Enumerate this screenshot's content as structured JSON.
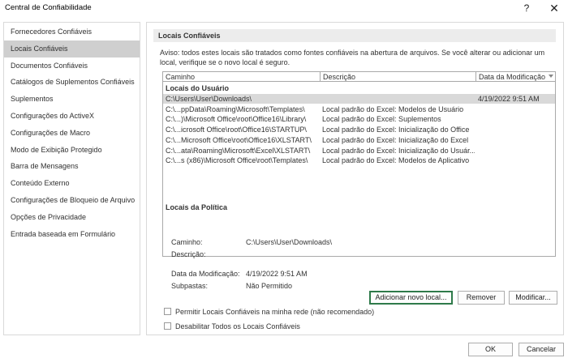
{
  "window": {
    "title": "Central de Confiabilidade",
    "help_label": "?",
    "close_label": "✕"
  },
  "sidebar": {
    "selected_index": 1,
    "items": [
      {
        "label": "Fornecedores Confiáveis"
      },
      {
        "label": "Locais Confiáveis"
      },
      {
        "label": "Documentos Confiáveis"
      },
      {
        "label": "Catálogos de Suplementos Confiáveis"
      },
      {
        "label": "Suplementos"
      },
      {
        "label": "Configurações do ActiveX"
      },
      {
        "label": "Configurações de Macro"
      },
      {
        "label": "Modo de Exibição Protegido"
      },
      {
        "label": "Barra de Mensagens"
      },
      {
        "label": "Conteúdo Externo"
      },
      {
        "label": "Configurações de Bloqueio de Arquivo"
      },
      {
        "label": "Opções de Privacidade"
      },
      {
        "label": "Entrada baseada em Formulário"
      }
    ]
  },
  "main": {
    "section_title": "Locais Confiáveis",
    "notice_line1": "Aviso: todos estes locais são tratados como fontes confiáveis na abertura de arquivos.  Se você alterar ou adicionar um",
    "notice_line2": "local, verifique se o novo local é seguro.",
    "columns": {
      "path": "Caminho",
      "description": "Descrição",
      "modified": "Data da Modificação"
    },
    "user_group_label": "Locais do Usuário",
    "policy_group_label": "Locais da Política",
    "user_rows": [
      {
        "path": "C:\\Users\\User\\Downloads\\",
        "description": "",
        "modified": "4/19/2022 9:51 AM",
        "selected": true
      },
      {
        "path": "C:\\...ppData\\Roaming\\Microsoft\\Templates\\",
        "description": "Local padrão do Excel: Modelos de Usuário",
        "modified": ""
      },
      {
        "path": "C:\\...)\\Microsoft Office\\root\\Office16\\Library\\",
        "description": "Local padrão do Excel: Suplementos",
        "modified": ""
      },
      {
        "path": "C:\\...icrosoft Office\\root\\Office16\\STARTUP\\",
        "description": "Local padrão do Excel: Inicialização do Office",
        "modified": ""
      },
      {
        "path": "C:\\...Microsoft Office\\root\\Office16\\XLSTART\\",
        "description": "Local padrão do Excel: Inicialização do Excel",
        "modified": ""
      },
      {
        "path": "C:\\...ata\\Roaming\\Microsoft\\Excel\\XLSTART\\",
        "description": "Local padrão do Excel: Inicialização do Usuár...",
        "modified": ""
      },
      {
        "path": "C:\\...s (x86)\\Microsoft Office\\root\\Templates\\",
        "description": "Local padrão do Excel: Modelos de Aplicativo",
        "modified": ""
      }
    ],
    "details": {
      "path_label": "Caminho:",
      "path_value": "C:\\Users\\User\\Downloads\\",
      "description_label": "Descrição:",
      "description_value": "",
      "modified_label": "Data da Modificação:",
      "modified_value": "4/19/2022 9:51 AM",
      "subfolders_label": "Subpastas:",
      "subfolders_value": "Não Permitido"
    },
    "buttons": {
      "add": "Adicionar novo local...",
      "remove": "Remover",
      "modify": "Modificar..."
    },
    "checkboxes": {
      "allow_network": {
        "label": "Permitir Locais Confiáveis na minha rede (não recomendado)",
        "checked": false
      },
      "disable_all": {
        "label": "Desabilitar Todos os Locais Confiáveis",
        "checked": false
      }
    }
  },
  "footer": {
    "ok": "OK",
    "cancel": "Cancelar"
  }
}
